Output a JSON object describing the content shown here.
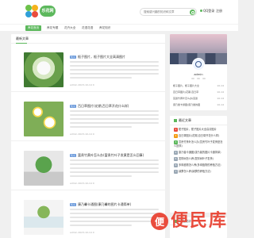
{
  "header": {
    "logo_text": "乐花网",
    "search_placeholder": "搜索感兴趣的知识和文章",
    "login_label": "QQ登录",
    "register_label": "注册"
  },
  "nav": [
    {
      "label": "养花首页",
      "active": true
    },
    {
      "label": "养花专题"
    },
    {
      "label": "花卉大全"
    },
    {
      "label": "花语花语"
    },
    {
      "label": "养花知识"
    }
  ],
  "main": {
    "title": "最新文章",
    "articles": [
      {
        "tag": "知识",
        "title": "栀子图片，栀子图片大全高清图片",
        "meta": "admin  2023-10-14  0"
      },
      {
        "tag": "知识",
        "title": "百日草图片(花期,百日草开花什么样)",
        "meta": "admin  2023-10-14  0"
      },
      {
        "tag": "知识",
        "title": "富贵竹黄叶怎么办(富贵竹叶子发黄是怎么回事)",
        "meta": "admin  2023-10-14  0"
      },
      {
        "tag": "知识",
        "title": "康乃馨卡通图(康乃馨的图片卡通简单)",
        "meta": "admin  2023-10-14  0"
      }
    ]
  },
  "sidebar": {
    "profile_name": "admin",
    "profile_items": [
      {
        "text": "栀子图片，栀子图片大全",
        "date": "10-14"
      },
      {
        "text": "百日草图片(花期,百日草",
        "date": "10-14"
      },
      {
        "text": "富贵竹黄叶怎么办(富贵",
        "date": "10-14"
      },
      {
        "text": "康乃馨卡通图(康乃馨的图",
        "date": "10-14"
      }
    ],
    "recent_title": "最近文章",
    "recent_items": [
      {
        "num": "1",
        "text": "栀子图片，栀子图片大全高清图片"
      },
      {
        "num": "2",
        "text": "百日草图片(花期,百日草开花什么样)"
      },
      {
        "num": "3",
        "text": "富贵竹黄叶怎么办(富贵竹叶子发黄是怎么回事)"
      },
      {
        "num": "4",
        "text": "康乃馨卡通图(康乃馨的图片卡通简单)"
      },
      {
        "num": "5",
        "text": "发财树怎么养(发财树叶子发黄)"
      },
      {
        "num": "6",
        "text": "多肉植物怎么养(多肉植物的养殖方法)"
      },
      {
        "num": "7",
        "text": "绿萝怎么养(绿萝的养殖方法)"
      }
    ],
    "stats_title": "网站统计"
  },
  "watermark": {
    "badge": "便",
    "text": "便民库"
  }
}
